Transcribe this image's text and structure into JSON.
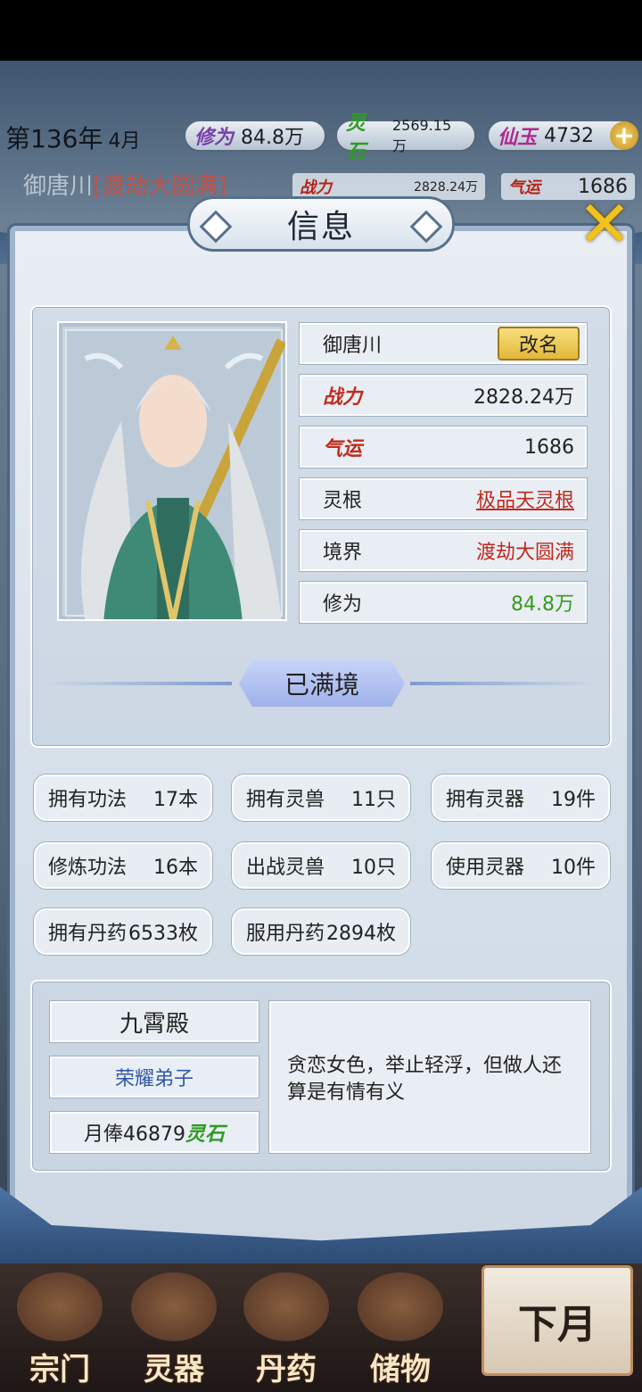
{
  "topbar": {
    "year": "第136年",
    "month": "4月",
    "resources": [
      {
        "tag": "修为",
        "value": "84.8万",
        "color": "#7a3fa8"
      },
      {
        "tag": "灵石",
        "value": "2569.15万",
        "color": "#2f9b24"
      },
      {
        "tag": "仙玉",
        "value": "4732",
        "color": "#b0288f"
      }
    ],
    "plus": "+"
  },
  "secondbar": {
    "name": "御唐川",
    "realm": "[渡劫大圆满]",
    "power_tag": "战力",
    "power_value": "2828.24万",
    "luck_tag": "气运",
    "luck_value": "1686"
  },
  "dialog": {
    "title": "信息",
    "close_icon": "✕"
  },
  "profile": {
    "name": "御唐川",
    "rename_label": "改名",
    "power_label": "战力",
    "power_value": "2828.24万",
    "luck_label": "气运",
    "luck_value": "1686",
    "root_label": "灵根",
    "root_value": "极品天灵根",
    "realm_label": "境界",
    "realm_value": "渡劫大圆满",
    "cult_label": "修为",
    "cult_value": "84.8万",
    "full_realm": "已满境"
  },
  "stats": [
    {
      "label": "拥有功法",
      "value": "17本"
    },
    {
      "label": "拥有灵兽",
      "value": "11只"
    },
    {
      "label": "拥有灵器",
      "value": "19件"
    },
    {
      "label": "修炼功法",
      "value": "16本"
    },
    {
      "label": "出战灵兽",
      "value": "10只"
    },
    {
      "label": "使用灵器",
      "value": "10件"
    },
    {
      "label": "拥有丹药",
      "value": "6533枚"
    },
    {
      "label": "服用丹药",
      "value": "2894枚"
    }
  ],
  "sect": {
    "name": "九霄殿",
    "rank": "荣耀弟子",
    "salary": "月俸46879",
    "salary_tag": "灵石",
    "description": "贪恋女色，举止轻浮，但做人还算是有情有义"
  },
  "nav": [
    {
      "label": "宗门"
    },
    {
      "label": "灵器"
    },
    {
      "label": "丹药"
    },
    {
      "label": "储物"
    }
  ],
  "next_month": "下月",
  "colors": {
    "accent_red": "#c12a1d",
    "green_value": "#3a9a1c",
    "rank_blue": "#3157a6",
    "gold_button": "#e8c24a"
  }
}
